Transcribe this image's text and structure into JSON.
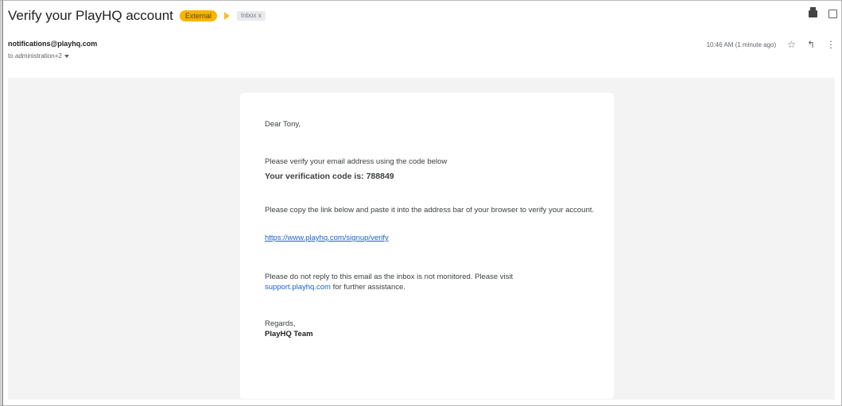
{
  "email": {
    "subject": "Verify your PlayHQ account",
    "labels": {
      "external": "External",
      "inbox": "Inbox x"
    },
    "sender": "notifications@playhq.com",
    "recipients": "to administration+2",
    "timestamp": "10:46 AM (1 minute ago)"
  },
  "icons": {
    "print": "print-icon",
    "open_new_window": "open-in-new-icon",
    "star": "star-icon",
    "reply": "reply-icon",
    "more": "more-vertical-icon",
    "importance": "importance-marker-icon"
  },
  "message": {
    "greeting": "Dear Tony,",
    "intro": "Please verify your email address using the code below",
    "code_line": "Your verification code is: 788849",
    "copy_instructions": "Please copy the link below and paste it into the address bar of your browser to verify your account.",
    "verify_link": "https://www.playhq.com/signup/verify",
    "noreply_prefix": "Please do not reply to this email as the inbox is not monitored. Please visit",
    "support_link": "support.playhq.com",
    "noreply_suffix": "for further assistance.",
    "regards": "Regards,",
    "team": "PlayHQ Team"
  },
  "colors": {
    "external_chip": "#f6b400",
    "importance_marker": "#f6c026",
    "link": "#1a62c5",
    "body_background": "#f3f3f3"
  }
}
